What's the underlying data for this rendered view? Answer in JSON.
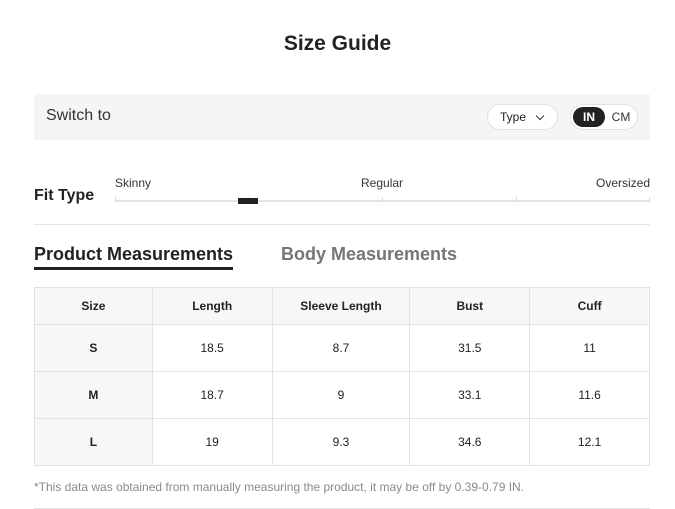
{
  "title": "Size Guide",
  "switch_bar": {
    "label": "Switch to",
    "type_select": "Type",
    "units": {
      "active": "IN",
      "inactive": "CM"
    }
  },
  "fit": {
    "label": "Fit Type",
    "scale": [
      "Skinny",
      "Regular",
      "Oversized"
    ],
    "level": 0.25
  },
  "tabs": [
    {
      "label": "Product Measurements",
      "active": true
    },
    {
      "label": "Body Measurements",
      "active": false
    }
  ],
  "table": {
    "headers": [
      "Size",
      "Length",
      "Sleeve Length",
      "Bust",
      "Cuff"
    ],
    "rows": [
      [
        "S",
        "18.5",
        "8.7",
        "31.5",
        "11"
      ],
      [
        "M",
        "18.7",
        "9",
        "33.1",
        "11.6"
      ],
      [
        "L",
        "19",
        "9.3",
        "34.6",
        "12.1"
      ]
    ]
  },
  "note": "*This data was obtained from manually measuring the product, it may be off by 0.39-0.79 IN."
}
